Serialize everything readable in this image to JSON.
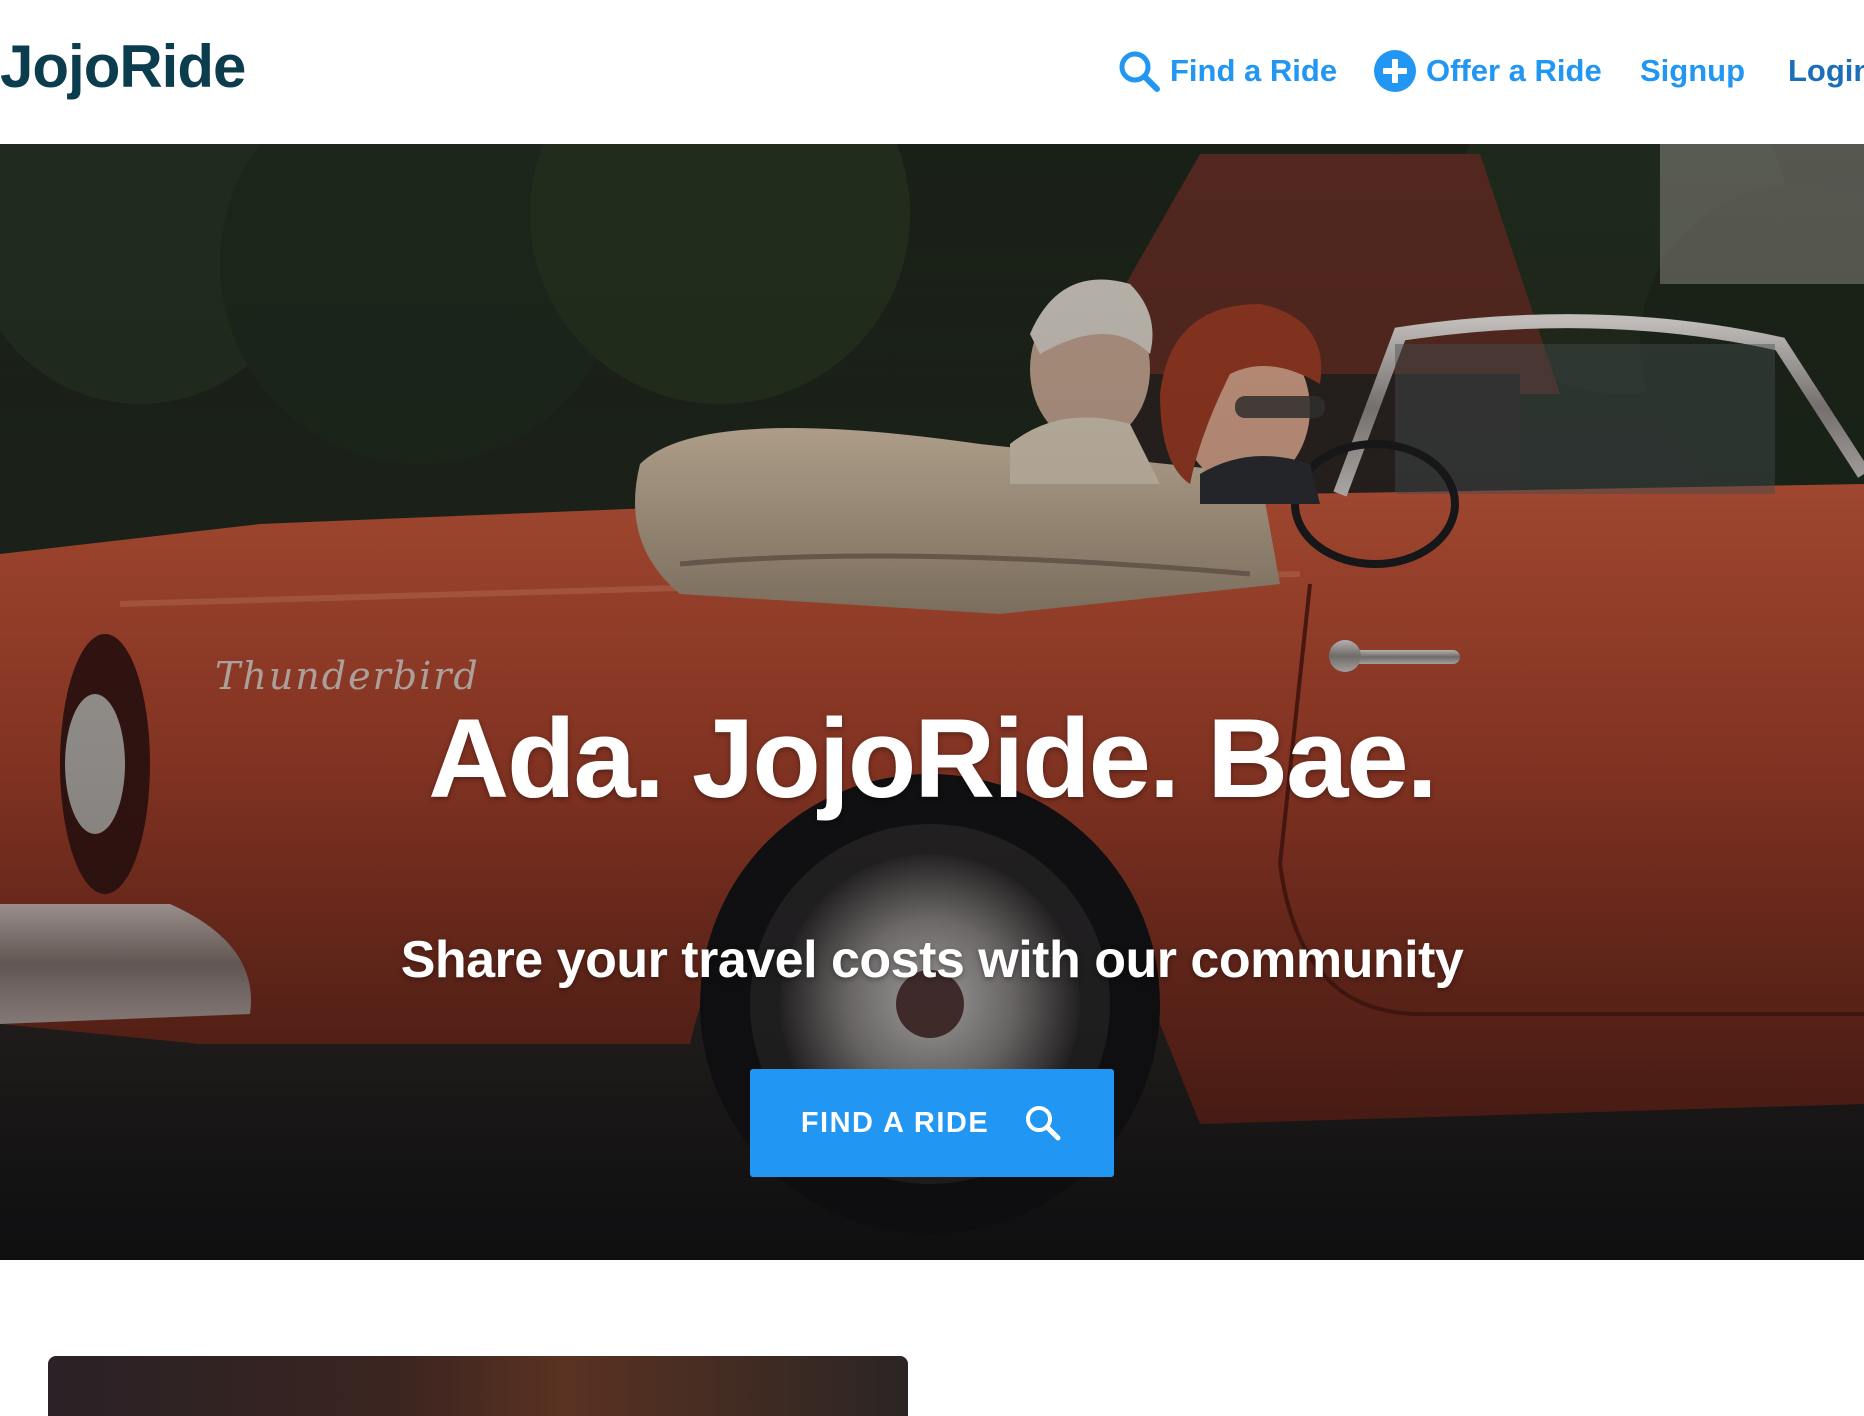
{
  "header": {
    "brand": "JojoRide",
    "nav": {
      "find_ride": {
        "label": "Find a Ride",
        "icon": "search-icon"
      },
      "offer_ride": {
        "label": "Offer a Ride",
        "icon": "plus-circle-icon"
      },
      "signup": {
        "label": "Signup"
      },
      "login": {
        "label": "Login"
      }
    }
  },
  "hero": {
    "title": "Ada. JojoRide. Bae.",
    "subtitle": "Share your travel costs with our community",
    "cta": {
      "label": "FIND A RIDE",
      "icon": "search-icon"
    },
    "car_script": "Thunderbird"
  },
  "colors": {
    "brand": "#0c3d4e",
    "accent": "#2196f3",
    "car_red": "#b4422a"
  }
}
